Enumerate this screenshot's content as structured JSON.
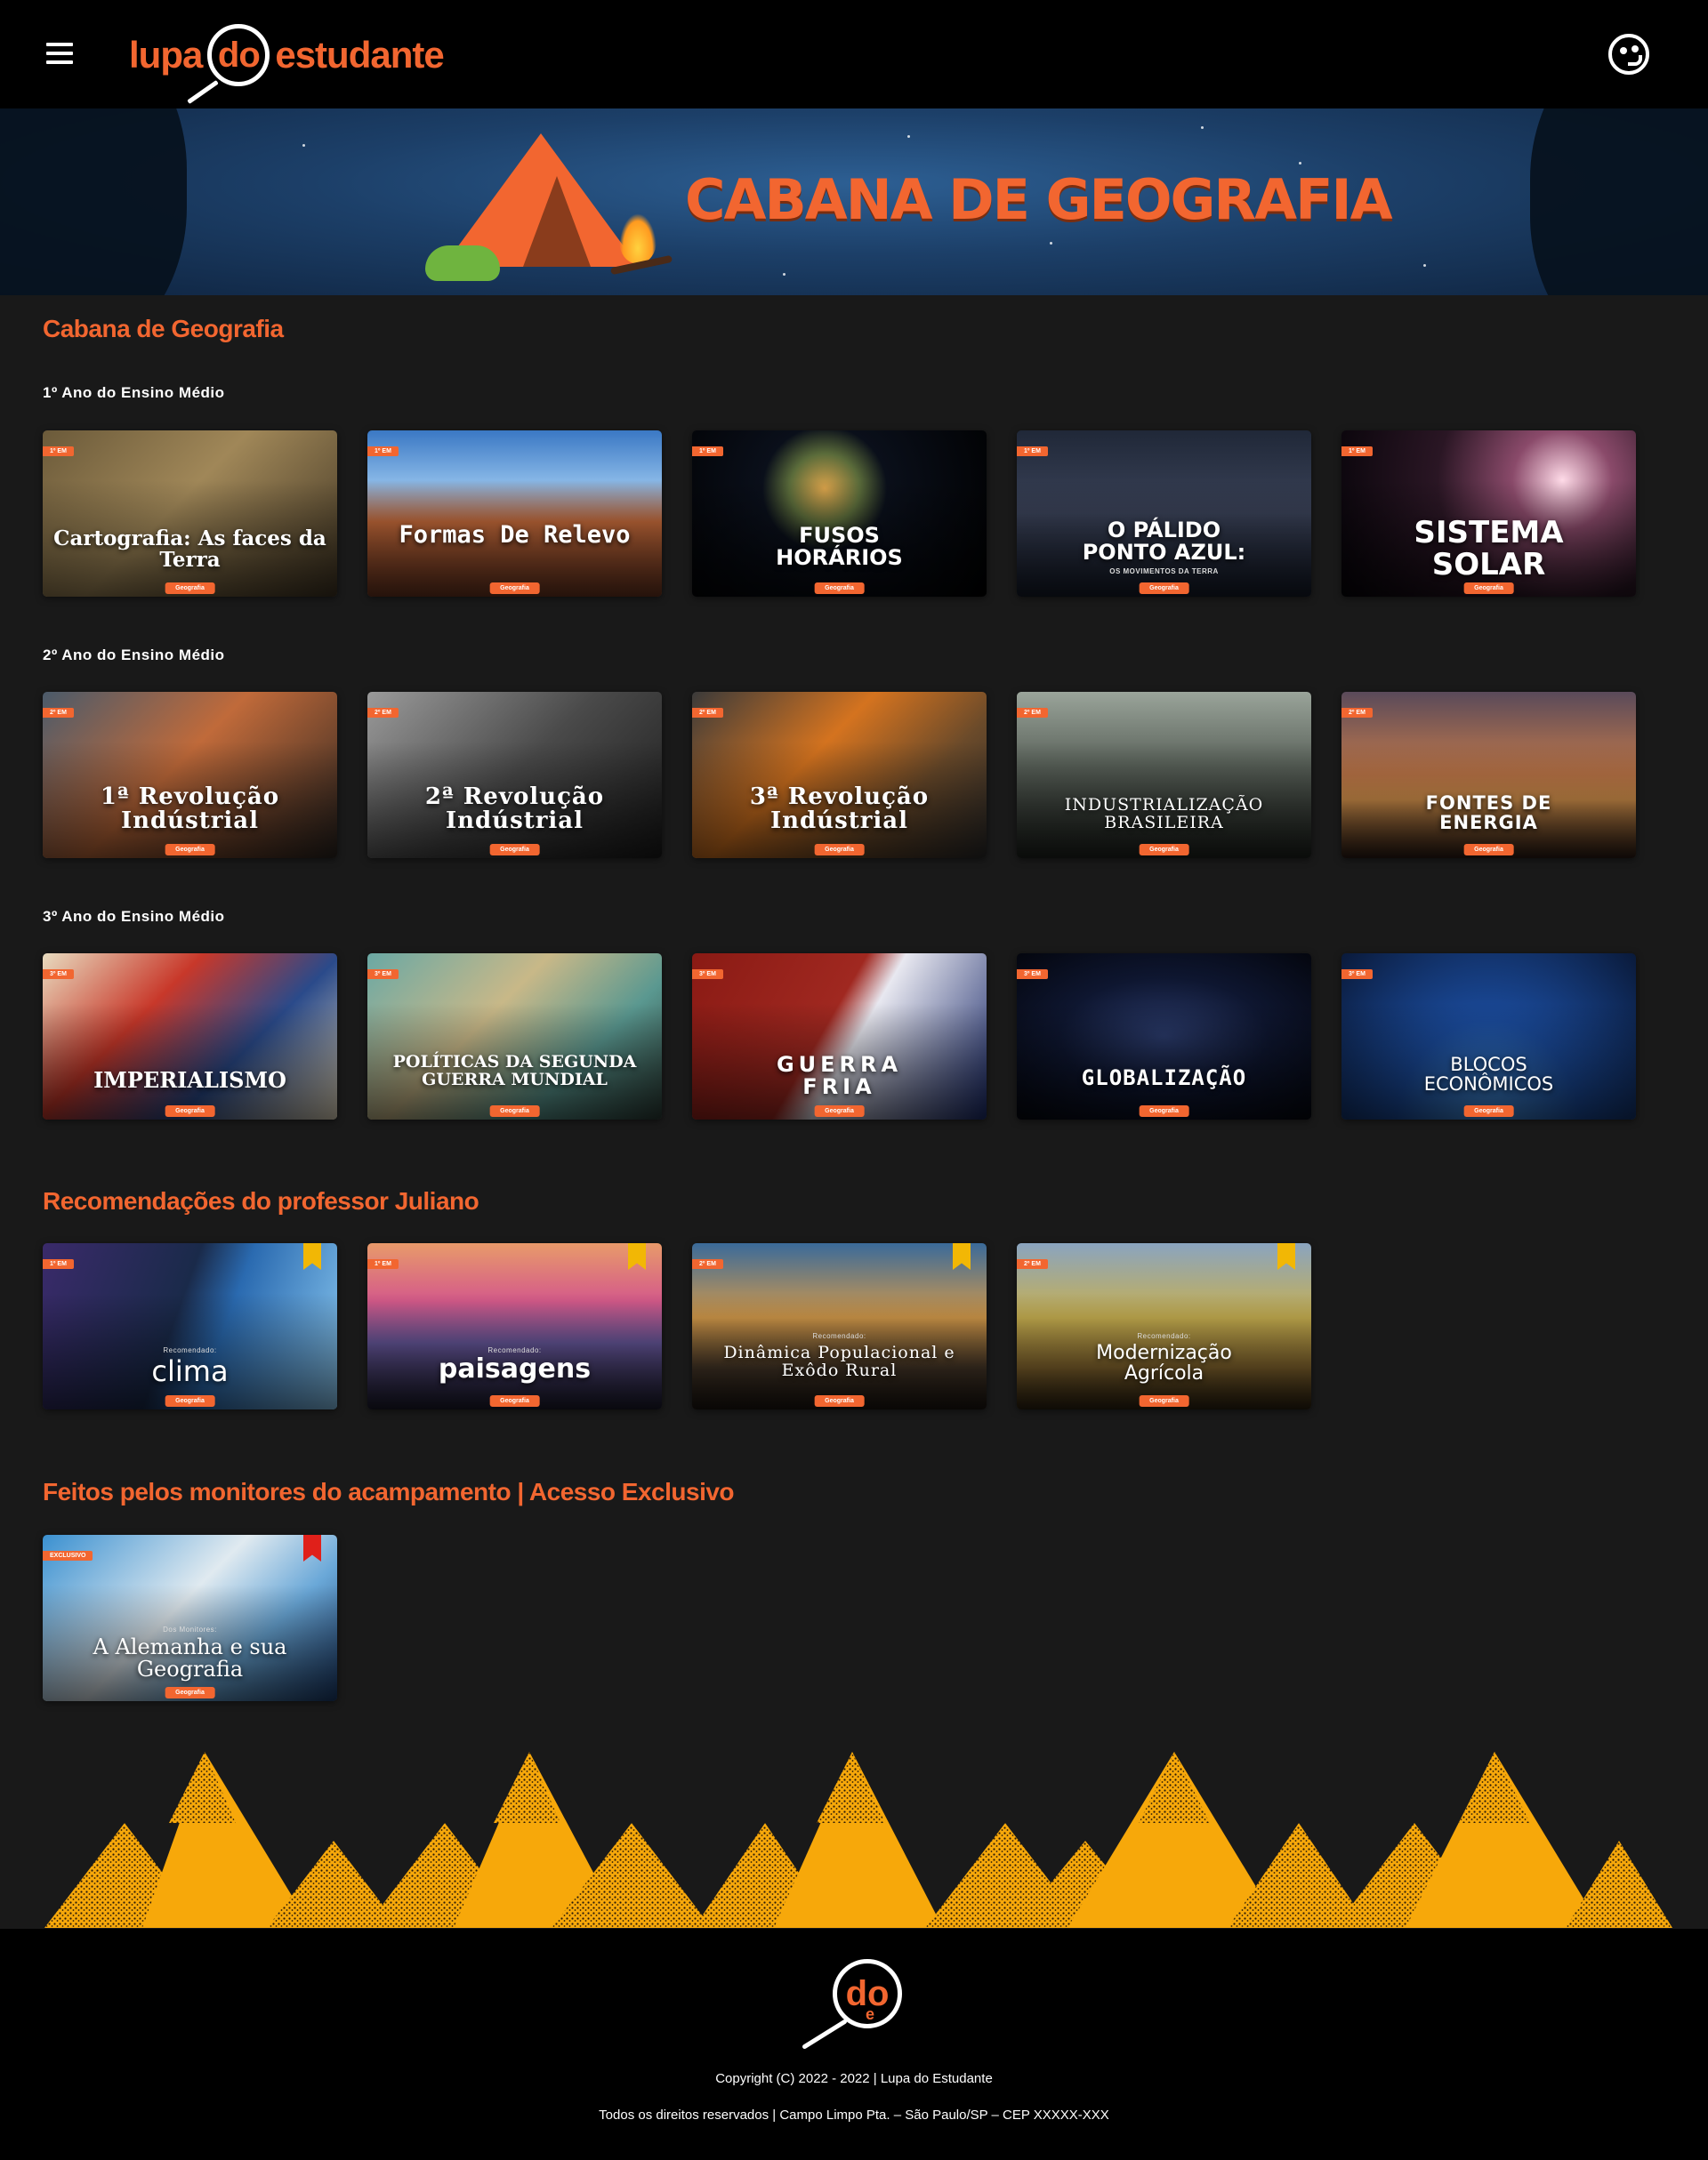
{
  "header": {
    "logo": {
      "part1": "lupa",
      "part2": "do",
      "part3": "estudante"
    },
    "menu_icon": "hamburger-menu-icon",
    "profile_icon": "user-avatar-icon"
  },
  "banner": {
    "title": "CABANA DE GEOGRAFIA"
  },
  "page_title": "Cabana de Geografia",
  "years": [
    {
      "title": "1º Ano do Ensino Médio",
      "cards": [
        {
          "tag": "1º EM",
          "title": "Cartografia: As faces da Terra",
          "badge": "Geografia",
          "bg": "linear-gradient(135deg,#6b5a3a 0%,#a08758 45%,#3e3322 100%)"
        },
        {
          "tag": "1º EM",
          "title": "Formas De Relevo",
          "badge": "Geografia",
          "bg": "linear-gradient(180deg,#3a78c4 0%,#86b6e6 30%,#c56a3a 55%,#6b3520 100%)"
        },
        {
          "tag": "1º EM",
          "title": "FUSOS HORÁRIOS",
          "badge": "Geografia",
          "bg": "radial-gradient(circle at 45% 35%,#d9a24a 0%,#5a6b3a 18%,#0a0f1a 32%,#000000 100%)"
        },
        {
          "tag": "1º EM",
          "title": "O PÁLIDO PONTO AZUL:",
          "subtitle": "OS MOVIMENTOS DA TERRA",
          "badge": "Geografia",
          "bg": "linear-gradient(180deg,#202838 0%,#3a4258 50%,#141a28 100%)"
        },
        {
          "tag": "1º EM",
          "title": "SISTEMA SOLAR",
          "badge": "Geografia",
          "bg": "radial-gradient(circle at 75% 30%,#ffdbe8 0%,#8a4a6a 20%,#2a1624 50%,#050308 100%)"
        }
      ]
    },
    {
      "title": "2º Ano do Ensino Médio",
      "cards": [
        {
          "tag": "2º EM",
          "title": "1ª Revolução Indústrial",
          "badge": "Geografia",
          "bg": "linear-gradient(135deg,#4a5a6a 0%,#c06a3a 45%,#2a2420 100%)"
        },
        {
          "tag": "2º EM",
          "title": "2ª Revolução Indústrial",
          "badge": "Geografia",
          "bg": "linear-gradient(135deg,#9a9a9a 0%,#4a4a4a 50%,#1a1a1a 100%)"
        },
        {
          "tag": "2º EM",
          "title": "3ª Revolução Indústrial",
          "badge": "Geografia",
          "bg": "linear-gradient(135deg,#3a3a3a 0%,#d4731f 40%,#6a4a2a 70%,#2a2a2a 100%)"
        },
        {
          "tag": "2º EM",
          "title": "INDUSTRIALIZAÇÃO BRASILEIRA",
          "badge": "Geografia",
          "bg": "linear-gradient(180deg,#9aa49a 0%,#5a625a 45%,#1e221e 100%)"
        },
        {
          "tag": "2º EM",
          "title": "FONTES DE ENERGIA",
          "badge": "Geografia",
          "bg": "linear-gradient(180deg,#5a4a5a 0%,#c47a4a 50%,#e09a50 65%,#2a1a14 100%)"
        }
      ]
    },
    {
      "title": "3º Ano do Ensino Médio",
      "cards": [
        {
          "tag": "3º EM",
          "title": "IMPERIALISMO",
          "badge": "Geografia",
          "bg": "linear-gradient(135deg,#e8dcc0 0%,#c8382a 35%,#2a4a8a 65%,#e8dcc0 100%)"
        },
        {
          "tag": "3º EM",
          "title": "POLÍTICAS DA SEGUNDA GUERRA MUNDIAL",
          "badge": "Geografia",
          "bg": "linear-gradient(135deg,#6aa8a4 0%,#c8b888 40%,#5a9890 70%,#2a3a34 100%)"
        },
        {
          "tag": "3º EM",
          "title": "GUERRA FRIA",
          "badge": "Geografia",
          "bg": "linear-gradient(120deg,#8a1a14 0%,#a02820 45%,#e8e8f0 55%,#1a2a6a 100%)"
        },
        {
          "tag": "3º EM",
          "title": "GLOBALIZAÇÃO",
          "badge": "Geografia",
          "bg": "radial-gradient(ellipse at 50% 50%,#2a3a6a 0%,#0e1630 50%,#04060e 100%)"
        },
        {
          "tag": "3º EM",
          "title": "BLOCOS ECONÔMICOS",
          "badge": "Geografia",
          "bg": "radial-gradient(ellipse at 50% 110%,#4a9ae8 0%,#1a4a9a 45%,#0a1a3a 100%)"
        }
      ]
    }
  ],
  "recommendations": {
    "title": "Recomendações do professor Juliano",
    "cards": [
      {
        "tag": "1º EM",
        "pre": "Recomendado:",
        "title": "clima",
        "badge": "Geografia",
        "bookmark": "#f2b705",
        "bg": "linear-gradient(110deg,#3a2a6a 0%,#1a2a4a 45%,#2a6ab0 60%,#8ac8f0 100%)"
      },
      {
        "tag": "1º EM",
        "pre": "Recomendado:",
        "title": "paisagens",
        "badge": "Geografia",
        "bookmark": "#f2b705",
        "bg": "linear-gradient(180deg,#e89a6a 0%,#d45a8a 35%,#6a5aa0 60%,#1a1a2a 100%)"
      },
      {
        "tag": "2º EM",
        "pre": "Recomendado:",
        "title": "Dinâmica Populacional e Exôdo Rural",
        "badge": "Geografia",
        "bookmark": "#f2b705",
        "bg": "linear-gradient(180deg,#3a6a9a 0%,#d49a4a 45%,#4a3a2a 75%,#1a1410 100%)"
      },
      {
        "tag": "2º EM",
        "pre": "Recomendado:",
        "title": "Modernização Agrícola",
        "badge": "Geografia",
        "bookmark": "#f2b705",
        "bg": "linear-gradient(180deg,#8aa4c0 0%,#c8b050 45%,#8a6a30 75%,#2a2010 100%)"
      }
    ]
  },
  "exclusive": {
    "title": "Feitos pelos monitores do acampamento | Acesso Exclusivo",
    "cards": [
      {
        "tag": "EXCLUSIVO",
        "pre": "Dos Monitores:",
        "title": "A Alemanha e sua Geografia",
        "badge": "Geografia",
        "bookmark": "#e0201a",
        "bg": "linear-gradient(135deg,#3a90d0 0%,#e0eaf0 45%,#6aa8d8 70%,#1a3a6a 100%)"
      }
    ]
  },
  "footer": {
    "logo": {
      "part1": "do",
      "part2": "e"
    },
    "copyright": "Copyright (C) 2022 - 2022 | Lupa do Estudante",
    "rights": "Todos os direitos reservados | Campo Limpo Pta. – São Paulo/SP – CEP XXXXX-XXX"
  },
  "colors": {
    "accent": "#f26630",
    "background": "#191919",
    "header": "#000000",
    "mountain": "#f7a80a"
  }
}
